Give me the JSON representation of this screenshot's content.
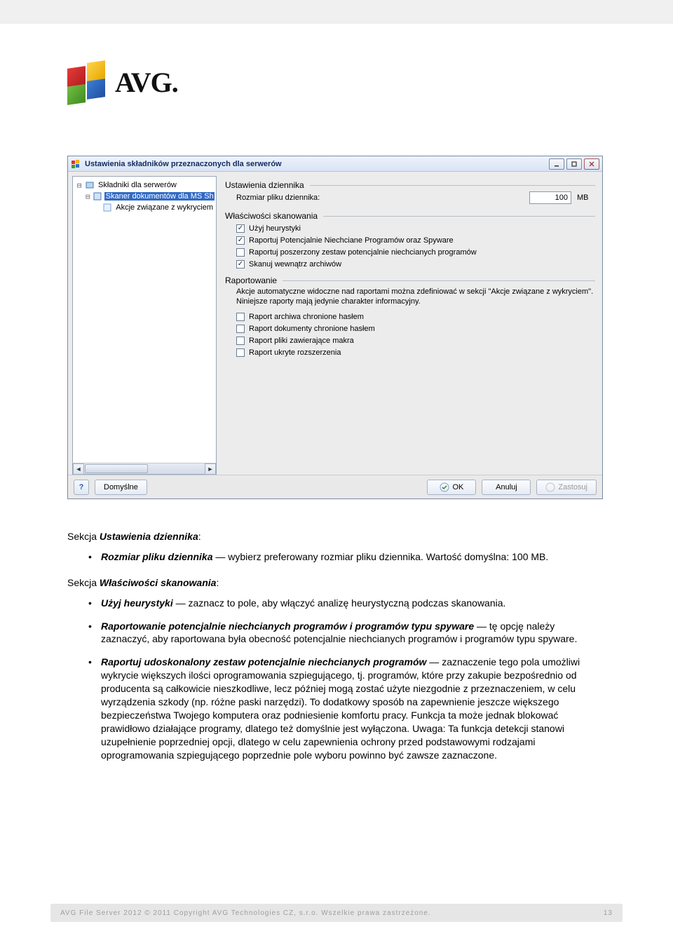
{
  "logo": {
    "text": "AVG."
  },
  "dialog": {
    "title": "Ustawienia składników przeznaczonych dla serwerów",
    "tree": {
      "root": "Składniki dla serwerów",
      "child1": "Skaner dokumentów dla MS Sh",
      "child2": "Akcje związane z wykryciem"
    },
    "log": {
      "heading": "Ustawienia dziennika",
      "sizeLabel": "Rozmiar pliku dziennika:",
      "sizeValue": "100",
      "unit": "MB"
    },
    "scan": {
      "heading": "Właściwości skanowania",
      "c1": "Użyj heurystyki",
      "c2": "Raportuj Potencjalnie Niechciane Programów oraz Spyware",
      "c3": "Raportuj poszerzony zestaw potencjalnie niechcianych programów",
      "c4": "Skanuj wewnątrz archiwów"
    },
    "report": {
      "heading": "Raportowanie",
      "desc": "Akcje automatyczne widoczne nad raportami można zdefiniować w sekcji \"Akcje związane z wykryciem\". Niniejsze raporty mają jedynie charakter informacyjny.",
      "r1": "Raport archiwa chronione hasłem",
      "r2": "Raport dokumenty chronione hasłem",
      "r3": "Raport pliki zawierające makra",
      "r4": "Raport ukryte rozszerzenia"
    },
    "buttons": {
      "default": "Domyślne",
      "ok": "OK",
      "cancel": "Anuluj",
      "apply": "Zastosuj"
    }
  },
  "doc": {
    "h1_a": "Sekcja ",
    "h1_b": "Ustawienia dziennika",
    "h1_c": ":",
    "li1_a": "Rozmiar pliku dziennika",
    "li1_b": " — wybierz preferowany rozmiar pliku dziennika. Wartość domyślna: 100 MB.",
    "h2_a": "Sekcja ",
    "h2_b": "Właściwości skanowania",
    "h2_c": ":",
    "li2_a": "Użyj heurystyki",
    "li2_b": " — zaznacz to pole, aby włączyć analizę heurystyczną podczas skanowania.",
    "li3_a": "Raportowanie potencjalnie niechcianych programów i programów typu spyware",
    "li3_b": " — tę opcję należy zaznaczyć, aby raportowana była obecność potencjalnie niechcianych programów i programów typu spyware.",
    "li4_a": "Raportuj udoskonalony zestaw potencjalnie niechcianych programów",
    "li4_b": " — zaznaczenie tego pola umożliwi wykrycie większych ilości oprogramowania szpiegującego, tj. programów, które przy zakupie bezpośrednio od producenta są całkowicie nieszkodliwe, lecz później mogą zostać użyte niezgodnie z przeznaczeniem, w celu wyrządzenia szkody (np. różne paski narzędzi). To dodatkowy sposób na zapewnienie jeszcze większego bezpieczeństwa Twojego komputera oraz podniesienie komfortu pracy. Funkcja ta może jednak blokować prawidłowo działające programy, dlatego też domyślnie jest wyłączona. Uwaga: Ta funkcja detekcji stanowi uzupełnienie poprzedniej opcji, dlatego w celu zapewnienia ochrony przed podstawowymi rodzajami oprogramowania szpiegującego poprzednie pole wyboru powinno być zawsze zaznaczone."
  },
  "footer": {
    "text": "AVG File Server 2012 © 2011 Copyright AVG Technologies CZ, s.r.o. Wszelkie prawa zastrzeżone.",
    "page": "13"
  }
}
